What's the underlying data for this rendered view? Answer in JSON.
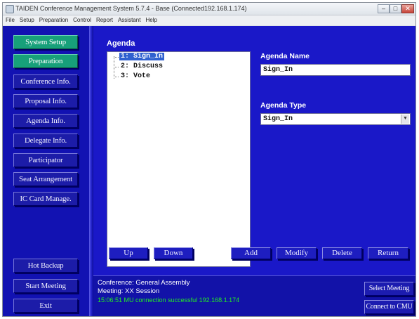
{
  "window": {
    "title": "TAIDEN Conference Management System 5.7.4 - Base (Connected192.168.1.174)",
    "controls": {
      "minimize": "–",
      "maximize": "□",
      "close": "✕"
    }
  },
  "menu": [
    "File",
    "Setup",
    "Preparation",
    "Control",
    "Report",
    "Assistant",
    "Help"
  ],
  "sidebar": {
    "system_setup": "System Setup",
    "preparation": "Preparation",
    "items": [
      "Conference Info.",
      "Proposal Info.",
      "Agenda Info.",
      "Delegate Info.",
      "Participator",
      "Seat Arrangement",
      "IC Card Manage."
    ],
    "hot_backup": "Hot Backup",
    "start_meeting": "Start Meeting",
    "exit": "Exit",
    "colors": {
      "active_green": "#17a07a",
      "button_blue": "#1c1ca8"
    }
  },
  "agenda": {
    "heading": "Agenda",
    "tree": [
      {
        "label": "1: Sign_In",
        "selected": true
      },
      {
        "label": "2: Discuss",
        "selected": false
      },
      {
        "label": "3: Vote",
        "selected": false
      }
    ],
    "name_label": "Agenda Name",
    "name_value": "Sign_In",
    "type_label": "Agenda Type",
    "type_value": "Sign_In",
    "buttons": {
      "up": "Up",
      "down": "Down",
      "add": "Add",
      "modify": "Modify",
      "delete": "Delete",
      "return": "Return"
    }
  },
  "status": {
    "conference": "Conference: General Assembly",
    "meeting": "Meeting: XX Session",
    "connection": "15:06:51 MU connection successful 192.168.1.174",
    "select_meeting": "Select Meeting",
    "connect_cmu": "Connect to CMU",
    "colors": {
      "connection_text": "#22ee22",
      "background": "#1a18c8"
    }
  }
}
